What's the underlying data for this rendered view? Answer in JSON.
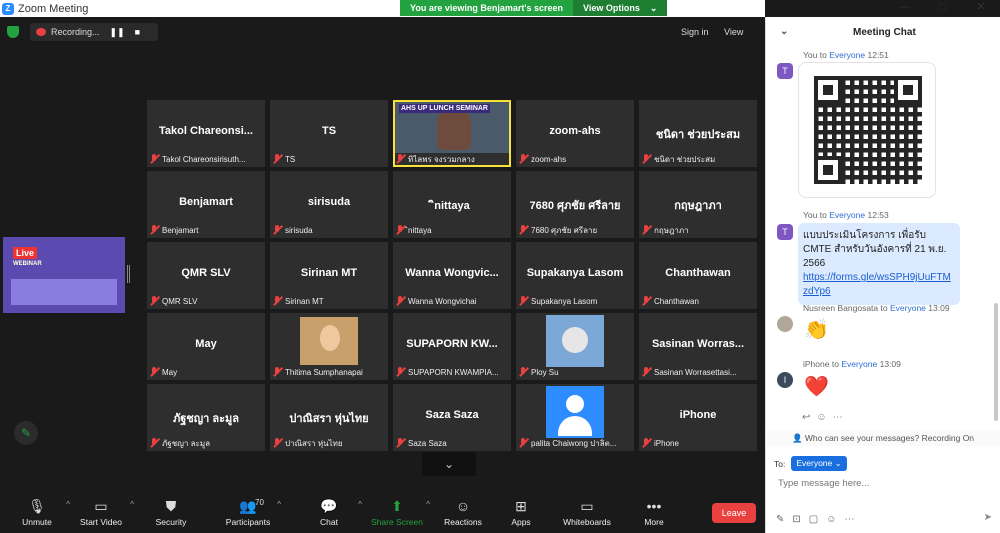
{
  "window": {
    "title": "Zoom Meeting",
    "minimize": "—",
    "maximize": "□",
    "close": "✕"
  },
  "banner": {
    "message": "You are viewing Benjamart's screen",
    "view_options": "View Options",
    "caret": "⌄"
  },
  "topbar": {
    "recording": "Recording...",
    "pause": "❚❚",
    "stop": "■",
    "sign_in": "Sign in",
    "view": "View"
  },
  "tiles": [
    {
      "big": "Takol  Chareonsi...",
      "label": "Takol Chareonsirisuth...",
      "kind": "text"
    },
    {
      "big": "TS",
      "label": "TS",
      "kind": "text"
    },
    {
      "big": "",
      "label": "ทิไลพร จงรวมกลาง",
      "kind": "video",
      "banner": "AHS UP LUNCH SEMINAR"
    },
    {
      "big": "zoom-ahs",
      "label": "zoom-ahs",
      "kind": "text"
    },
    {
      "big": "ชนิดา ช่วยประสม",
      "label": "ชนิดา ช่วยประสม",
      "kind": "text"
    },
    {
      "big": "Benjamart",
      "label": "Benjamart",
      "kind": "text"
    },
    {
      "big": "sirisuda",
      "label": "sirisuda",
      "kind": "text"
    },
    {
      "big": "ิnittaya",
      "label": "ิnittaya",
      "kind": "text"
    },
    {
      "big": "7680 ศุภชัย ศรีลาย",
      "label": "7680 ศุภชัย ศรีลาย",
      "kind": "text"
    },
    {
      "big": "กฤษฎาภา",
      "label": "กฤษฎาภา",
      "kind": "text"
    },
    {
      "big": "QMR SLV",
      "label": "QMR SLV",
      "kind": "text"
    },
    {
      "big": "Sirinan MT",
      "label": "Sirinan MT",
      "kind": "text"
    },
    {
      "big": "Wanna  Wongvic...",
      "label": "Wanna Wongvichai",
      "kind": "text"
    },
    {
      "big": "Supakanya Lasom",
      "label": "Supakanya Lasom",
      "kind": "text"
    },
    {
      "big": "Chanthawan",
      "label": "Chanthawan",
      "kind": "text"
    },
    {
      "big": "May",
      "label": "May",
      "kind": "text"
    },
    {
      "big": "",
      "label": "Thitima Sumphanapai",
      "kind": "photo"
    },
    {
      "big": "SUPAPORN  KW...",
      "label": "SUPAPORN KWAMPIA...",
      "kind": "text"
    },
    {
      "big": "",
      "label": "Ploy Su",
      "kind": "art"
    },
    {
      "big": "Sasinan  Worras...",
      "label": "Sasinan Worrasettasi...",
      "kind": "text"
    },
    {
      "big": "ภัฐชญา ละมูล",
      "label": "ภัฐชญา ละมูล",
      "kind": "text"
    },
    {
      "big": "ปาณิสรา หุ่นไทย",
      "label": "ปาณิสรา หุ่นไทย",
      "kind": "text"
    },
    {
      "big": "Saza Saza",
      "label": "Saza Saza",
      "kind": "text"
    },
    {
      "big": "",
      "label": "palita Chaiwong ปาลิต...",
      "kind": "default"
    },
    {
      "big": "iPhone",
      "label": "iPhone",
      "kind": "text"
    }
  ],
  "share_thumb": {
    "live": "Live",
    "sub": "WEBINAR"
  },
  "toolbar": {
    "unmute": "Unmute",
    "start_video": "Start Video",
    "security": "Security",
    "participants": "Participants",
    "participants_count": "70",
    "chat": "Chat",
    "share_screen": "Share Screen",
    "reactions": "Reactions",
    "apps": "Apps",
    "whiteboards": "Whiteboards",
    "more": "More",
    "leave": "Leave"
  },
  "chat": {
    "title": "Meeting Chat",
    "messages": [
      {
        "sender": "You",
        "to_word": "to",
        "recipient": "Everyone",
        "time": "12:51",
        "avatar": "T"
      },
      {
        "sender": "You",
        "to_word": "to",
        "recipient": "Everyone",
        "time": "12:53",
        "avatar": "T",
        "text1": "แบบประเมินโครงการ เพื่อรับ CMTE สำหรับวันอังคารที่ 21 พ.ย. 2566",
        "link": "https://forms.gle/wsSPH9jUuFTMzdYp6"
      },
      {
        "sender": "Nusreen Bangosata",
        "to_word": "to",
        "recipient": "Everyone",
        "time": "13:09",
        "emoji": "👏"
      },
      {
        "sender": "iPhone",
        "to_word": "to",
        "recipient": "Everyone",
        "time": "13:09",
        "avatar": "I",
        "emoji": "❤️"
      }
    ],
    "privacy": "Who can see your messages? Recording On",
    "to_label": "To:",
    "to_value": "Everyone",
    "placeholder": "Type message here..."
  }
}
